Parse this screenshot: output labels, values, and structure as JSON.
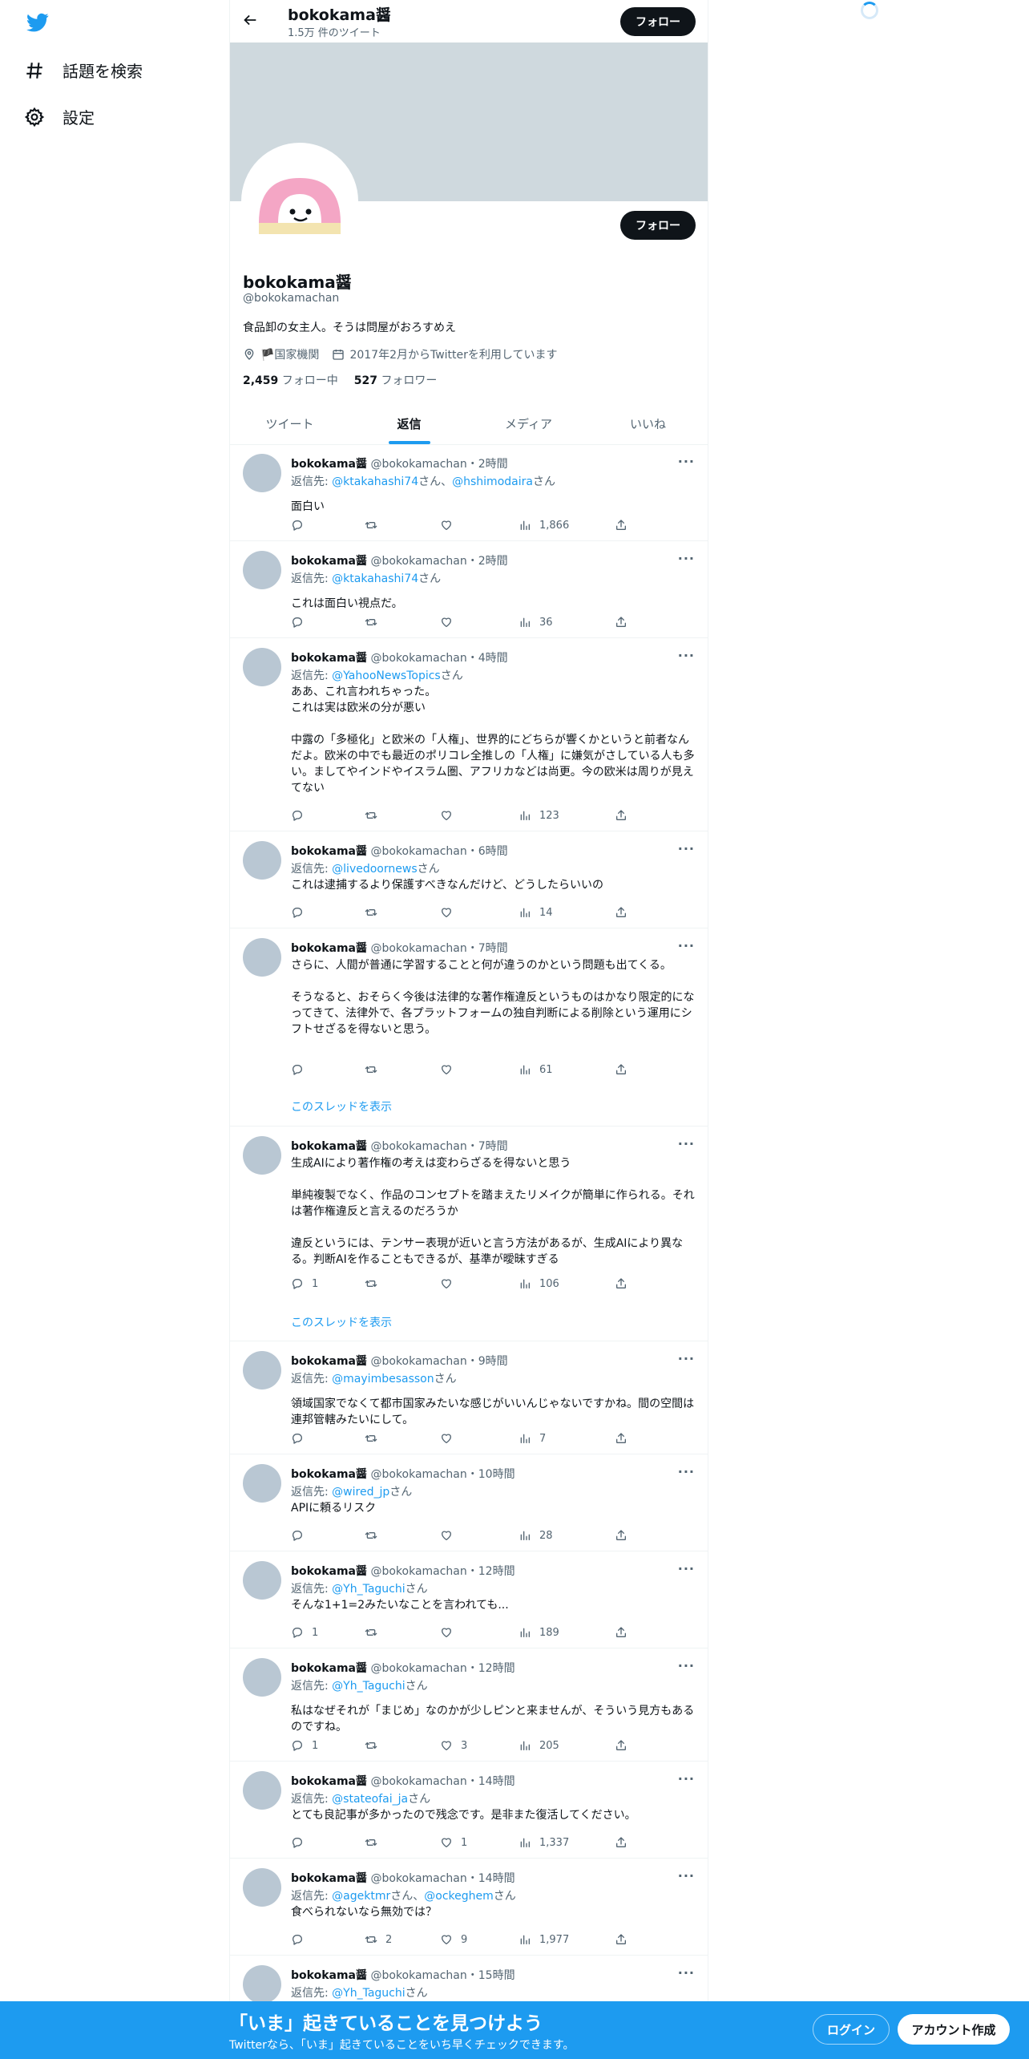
{
  "nav": {
    "explore_label": "話題を検索",
    "settings_label": "設定"
  },
  "header": {
    "name": "bokokama醤",
    "tweet_count": "1.5万 件のツイート",
    "follow_label": "フォロー"
  },
  "profile": {
    "name": "bokokama醤",
    "handle": "@bokokamachan",
    "bio": "食品卸の女主人。そうは問屋がおろすめえ",
    "location": "🏴国家機関",
    "joined": "2017年2月からTwitterを利用しています",
    "following_count": "2,459",
    "following_label": "フォロー中",
    "followers_count": "527",
    "followers_label": "フォロワー",
    "follow_label": "フォロー"
  },
  "tabs": [
    "ツイート",
    "返信",
    "メディア",
    "いいね"
  ],
  "active_tab": "返信",
  "reply_prefix": "返信先:",
  "thread_label": "このスレッドを表示",
  "tweets": [
    {
      "name": "bokokama醤",
      "handle": "@bokokamachan",
      "time": "・2時間",
      "reply_line": "返信先: @ktakahashi74さん、@hshimodairaさん",
      "text": "面白い",
      "stats": {
        "reply": "",
        "retweet": "",
        "like": "",
        "views": "1,866"
      }
    },
    {
      "name": "bokokama醤",
      "handle": "@bokokamachan",
      "time": "・2時間",
      "reply_line": "返信先: @ktakahashi74さん",
      "text": "これは面白い視点だ。",
      "stats": {
        "reply": "",
        "retweet": "",
        "like": "",
        "views": "36"
      }
    },
    {
      "name": "bokokama醤",
      "handle": "@bokokamachan",
      "time": "・4時間",
      "reply_line": "返信先: @YahooNewsTopicsさん",
      "text": "ああ、これ言われちゃった。\nこれは実は欧米の分が悪い\n\n中露の「多極化」と欧米の「人権」、世界的にどちらが響くかというと前者なんだよ。欧米の中でも最近のポリコレ全推しの「人権」に嫌気がさしている人も多い。ましてやインドやイスラム圏、アフリカなどは尚更。今の欧米は周りが見えてない",
      "stats": {
        "reply": "",
        "retweet": "",
        "like": "",
        "views": "123"
      }
    },
    {
      "name": "bokokama醤",
      "handle": "@bokokamachan",
      "time": "・6時間",
      "reply_line": "返信先: @livedoornewsさん",
      "text": "これは逮捕するより保護すべきなんだけど、どうしたらいいの",
      "stats": {
        "reply": "",
        "retweet": "",
        "like": "",
        "views": "14"
      }
    },
    {
      "name": "bokokama醤",
      "handle": "@bokokamachan",
      "time": "・7時間",
      "reply_line": "",
      "text": "さらに、人間が普通に学習することと何が違うのかという問題も出てくる。\n\nそうなると、おそらく今後は法律的な著作権違反というものはかなり限定的になってきて、法律外で、各プラットフォームの独自判断による削除という運用にシフトせざるを得ないと思う。",
      "stats": {
        "reply": "",
        "retweet": "",
        "like": "",
        "views": "61"
      },
      "thread": true
    },
    {
      "name": "bokokama醤",
      "handle": "@bokokamachan",
      "time": "・7時間",
      "reply_line": "",
      "text": "生成AIにより著作権の考えは変わらざるを得ないと思う\n\n単純複製でなく、作品のコンセプトを踏まえたリメイクが簡単に作られる。それは著作権違反と言えるのだろうか\n\n違反というには、テンサー表現が近いと言う方法があるが、生成AIにより異なる。判断AIを作ることもできるが、基準が曖昧すぎる",
      "stats": {
        "reply": "1",
        "retweet": "",
        "like": "",
        "views": "106"
      },
      "thread": true
    },
    {
      "name": "bokokama醤",
      "handle": "@bokokamachan",
      "time": "・9時間",
      "reply_line": "返信先: @mayimbesassonさん",
      "text": "領域国家でなくて都市国家みたいな感じがいいんじゃないですかね。間の空間は連邦管轄みたいにして。",
      "stats": {
        "reply": "",
        "retweet": "",
        "like": "",
        "views": "7"
      }
    },
    {
      "name": "bokokama醤",
      "handle": "@bokokamachan",
      "time": "・10時間",
      "reply_line": "返信先: @wired_jpさん",
      "text": "APIに頼るリスク",
      "stats": {
        "reply": "",
        "retweet": "",
        "like": "",
        "views": "28"
      }
    },
    {
      "name": "bokokama醤",
      "handle": "@bokokamachan",
      "time": "・12時間",
      "reply_line": "返信先: @Yh_Taguchiさん",
      "text": "そんな1+1=2みたいなことを言われても...",
      "stats": {
        "reply": "1",
        "retweet": "",
        "like": "",
        "views": "189"
      }
    },
    {
      "name": "bokokama醤",
      "handle": "@bokokamachan",
      "time": "・12時間",
      "reply_line": "返信先: @Yh_Taguchiさん",
      "text": "私はなぜそれが「まじめ」なのかが少しピンと来ませんが、そういう見方もあるのですね。",
      "stats": {
        "reply": "1",
        "retweet": "",
        "like": "3",
        "views": "205"
      }
    },
    {
      "name": "bokokama醤",
      "handle": "@bokokamachan",
      "time": "・14時間",
      "reply_line": "返信先: @stateofai_jaさん",
      "text": "とても良記事が多かったので残念です。是非また復活してください。",
      "stats": {
        "reply": "",
        "retweet": "",
        "like": "1",
        "views": "1,337"
      }
    },
    {
      "name": "bokokama醤",
      "handle": "@bokokamachan",
      "time": "・14時間",
      "reply_line": "返信先: @agektmrさん、@ockeghemさん",
      "text": "食べられないなら無効では？",
      "stats": {
        "reply": "",
        "retweet": "2",
        "like": "9",
        "views": "1,977"
      }
    },
    {
      "name": "bokokama醤",
      "handle": "@bokokamachan",
      "time": "・15時間",
      "reply_line": "返信先: @Yh_Taguchiさん",
      "text": "",
      "stats": {
        "reply": "",
        "retweet": "",
        "like": "",
        "views": ""
      }
    }
  ],
  "bottom_bar": {
    "title": "「いま」起きていることを見つけよう",
    "subtitle": "Twitterなら、「いま」起きていることをいち早くチェックできます。",
    "login_label": "ログイン",
    "signup_label": "アカウント作成"
  }
}
